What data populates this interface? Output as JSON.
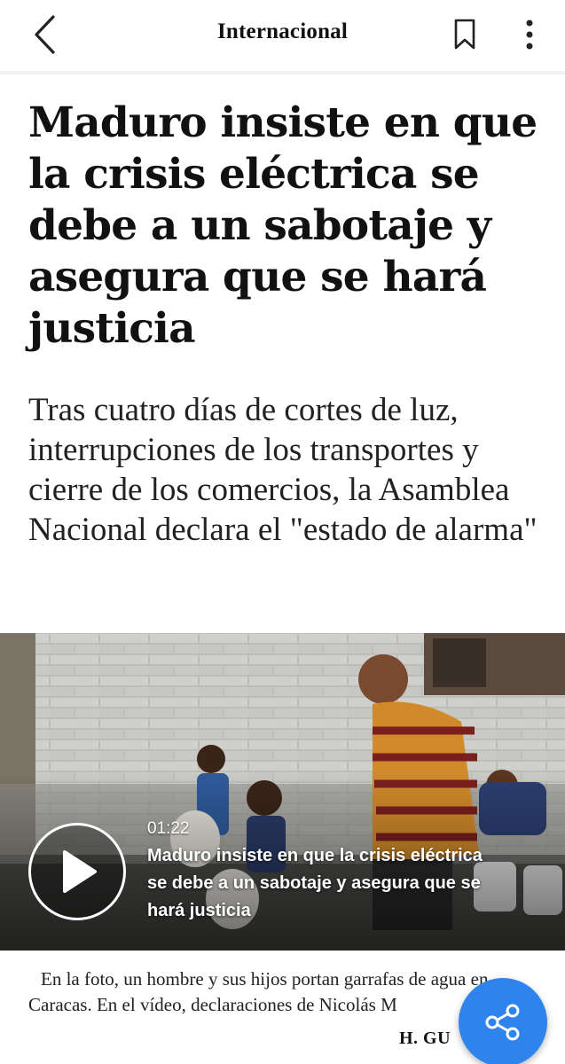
{
  "header": {
    "section": "Internacional",
    "back_icon": "chevron-left-icon",
    "bookmark_icon": "bookmark-icon",
    "more_icon": "more-vertical-icon"
  },
  "article": {
    "headline": "Maduro insiste en que la crisis eléctrica se debe a un sabotaje y asegura que se hará justicia",
    "subtitle": "Tras cuatro días de cortes de luz, interrupciones de los transportes y cierre de los comercios, la Asamblea Nacional declara el \"estado de alarma\""
  },
  "video": {
    "duration": "01:22",
    "title": "Maduro insiste en que la crisis eléctrica se debe a un sabotaje y asegura que se hará justicia",
    "play_icon": "play-icon"
  },
  "caption": {
    "text": "En la foto, un hombre y sus hijos portan garrafas de agua en Caracas. En el vídeo, declaraciones de Nicolás M",
    "credit": "H. GU"
  },
  "share": {
    "icon": "share-icon",
    "color": "#2e84ec"
  }
}
